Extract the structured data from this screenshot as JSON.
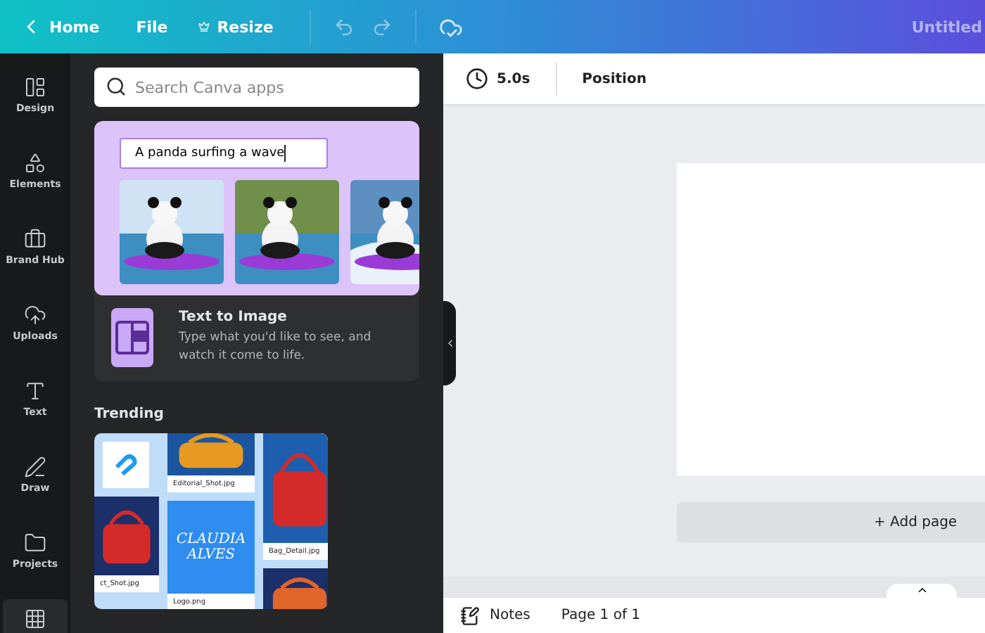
{
  "topbar": {
    "back": "Home",
    "menu": [
      {
        "label": "File",
        "kind": "plain"
      },
      {
        "label": "Resize",
        "kind": "crown"
      }
    ],
    "title": "Untitled"
  },
  "rail": [
    {
      "label": "Design",
      "kind": "layout",
      "selected": false
    },
    {
      "label": "Elements",
      "kind": "shapes",
      "selected": false
    },
    {
      "label": "Brand Hub",
      "kind": "brand",
      "selected": false
    },
    {
      "label": "Uploads",
      "kind": "upload",
      "selected": false
    },
    {
      "label": "Text",
      "kind": "text",
      "selected": false
    },
    {
      "label": "Draw",
      "kind": "draw",
      "selected": false
    },
    {
      "label": "Projects",
      "kind": "folder",
      "selected": false
    },
    {
      "kind": "grid",
      "selected": true
    }
  ],
  "panel": {
    "search": {
      "placeholder": "Search Canva apps"
    },
    "feature": {
      "prompt": "A panda surfing a wave",
      "title": "Text to Image",
      "description": "Type what you'd like to see, and watch it come to life."
    },
    "trending": {
      "heading": "Trending",
      "files": [
        "Editorial_Shot.jpg",
        "Bag_Detail.jpg",
        "ct_Shot.jpg",
        "Logo.png"
      ],
      "logo_lines": [
        "CLAUDIA",
        "ALVES"
      ]
    }
  },
  "toolbar": {
    "duration": "5.0s",
    "position": "Position"
  },
  "canvas": {
    "add_page": "+ Add page"
  },
  "footer": {
    "notes": "Notes",
    "page": "Page 1 of 1"
  }
}
